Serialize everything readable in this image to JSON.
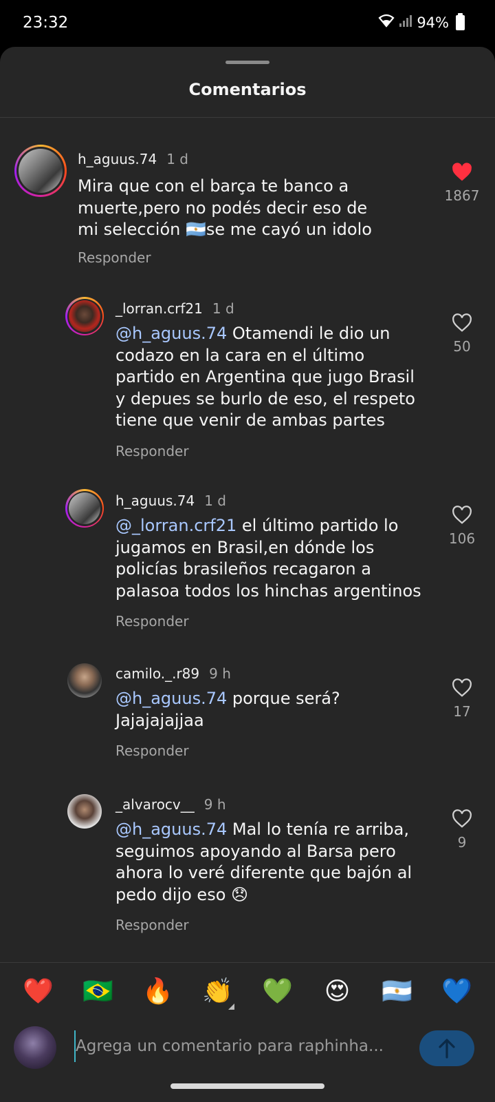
{
  "status_bar": {
    "time": "23:32",
    "battery": "94%"
  },
  "sheet": {
    "title": "Comentarios"
  },
  "comments": [
    {
      "user": "h_aguus.74",
      "time": "1 d",
      "mention": "",
      "text": "Mira que con el barça te banco a muerte,pero no podés decir eso de mi selección 🇦🇷se me cayó un idolo",
      "reply_label": "Responder",
      "likes": "1867",
      "liked": true
    },
    {
      "user": "_lorran.crf21",
      "time": "1 d",
      "mention": "@h_aguus.74",
      "text": "Otamendi le dio un codazo en la cara en el último partido en Argentina que jugo Brasil y depues se burlo de eso, el respeto tiene que venir de ambas partes",
      "reply_label": "Responder",
      "likes": "50",
      "liked": false
    },
    {
      "user": "h_aguus.74",
      "time": "1 d",
      "mention": "@_lorran.crf21",
      "text": "el último partido lo jugamos en Brasil,en dónde los policías brasileños recagaron a palasoa todos los hinchas argentinos",
      "reply_label": "Responder",
      "likes": "106",
      "liked": false
    },
    {
      "user": "camilo._.r89",
      "time": "9 h",
      "mention": "@h_aguus.74",
      "text": "porque será? Jajajajajjaa",
      "reply_label": "Responder",
      "likes": "17",
      "liked": false
    },
    {
      "user": "_alvarocv__",
      "time": "9 h",
      "mention": "@h_aguus.74",
      "text": "Mal lo tenía re arriba, seguimos apoyando al Barsa pero ahora lo veré diferente que bajón al pedo dijo eso 😞",
      "reply_label": "Responder",
      "likes": "9",
      "liked": false
    }
  ],
  "emoji_bar": [
    "❤️",
    "🇧🇷",
    "🔥",
    "👏",
    "💚",
    "😍",
    "🇦🇷",
    "💙"
  ],
  "input": {
    "placeholder": "Agrega un comentario para raphinha..."
  },
  "colors": {
    "background": "#262626",
    "mention": "#a9c8ff",
    "like_red": "#ff3040",
    "send_button": "#1a4e7e"
  },
  "icons": {
    "like": "heart-icon",
    "send": "arrow-up-icon",
    "wifi": "wifi-icon",
    "signal": "signal-icon",
    "battery": "battery-icon"
  }
}
